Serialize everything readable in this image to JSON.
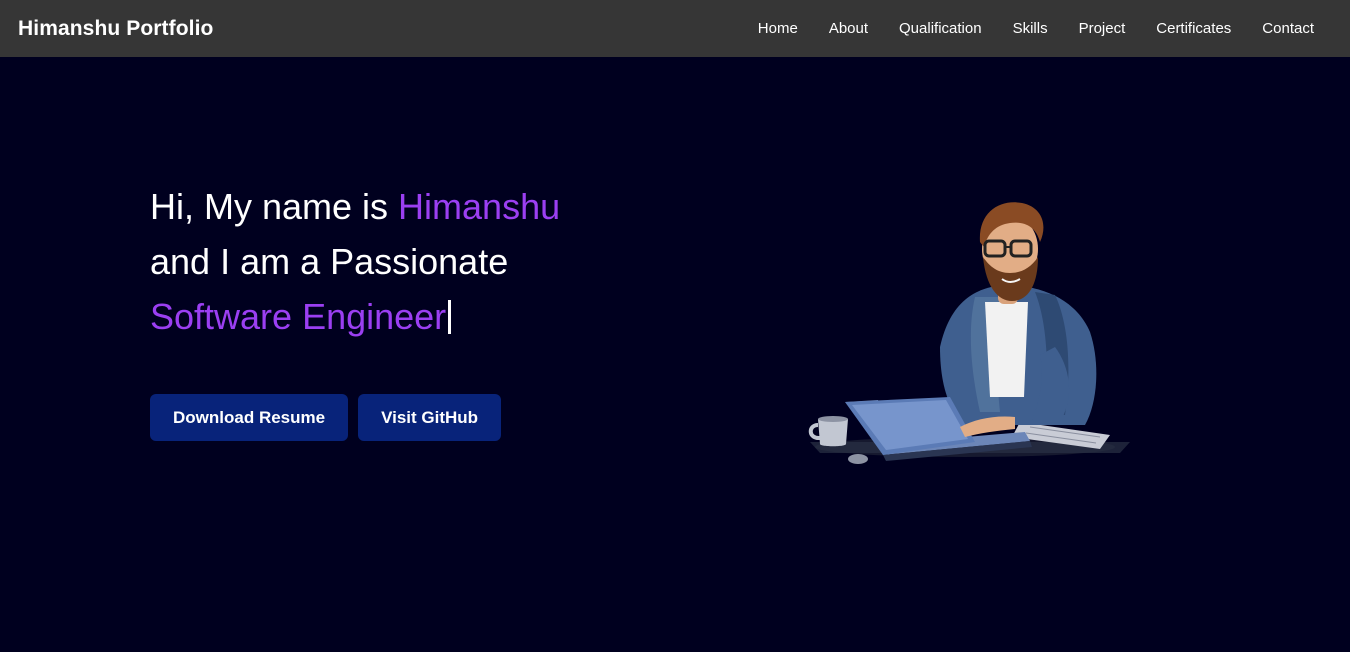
{
  "navbar": {
    "brand": "Himanshu Portfolio",
    "links": [
      "Home",
      "About",
      "Qualification",
      "Skills",
      "Project",
      "Certificates",
      "Contact"
    ]
  },
  "hero": {
    "line1_prefix": "Hi, My name is ",
    "line1_name": "Himanshu",
    "line2": "and I am a Passionate",
    "line3_role": "Software Engineer",
    "buttons": {
      "download_resume": "Download Resume",
      "visit_github": "Visit GitHub"
    },
    "illustration_icon": "developer-with-laptop-illustration"
  },
  "colors": {
    "background": "#00001f",
    "navbar": "#363636",
    "accent": "#9b3ff2",
    "button": "#08237a"
  }
}
